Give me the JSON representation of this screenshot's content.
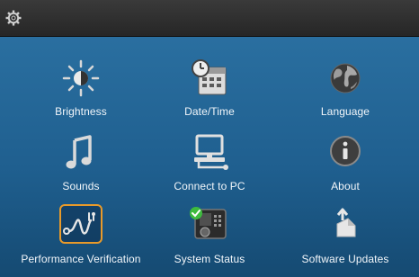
{
  "topbar": {
    "settings_icon": "gear-icon"
  },
  "tiles": [
    {
      "label": "Brightness",
      "icon": "brightness-icon",
      "selected": false
    },
    {
      "label": "Date/Time",
      "icon": "calendar-clock-icon",
      "selected": false
    },
    {
      "label": "Language",
      "icon": "globe-icon",
      "selected": false
    },
    {
      "label": "Sounds",
      "icon": "music-note-icon",
      "selected": false
    },
    {
      "label": "Connect to PC",
      "icon": "computer-icon",
      "selected": false
    },
    {
      "label": "About",
      "icon": "info-icon",
      "selected": false
    },
    {
      "label": "Performance Verification",
      "icon": "stethoscope-icon",
      "selected": true
    },
    {
      "label": "System Status",
      "icon": "device-status-icon",
      "selected": false
    },
    {
      "label": "Software Updates",
      "icon": "software-update-icon",
      "selected": false
    }
  ],
  "colors": {
    "background_top": "#2a6fa0",
    "background_bottom": "#154a72",
    "selection_border": "#e89a2a",
    "label_text": "#f2f6fa",
    "status_check": "#3dbb3d"
  }
}
